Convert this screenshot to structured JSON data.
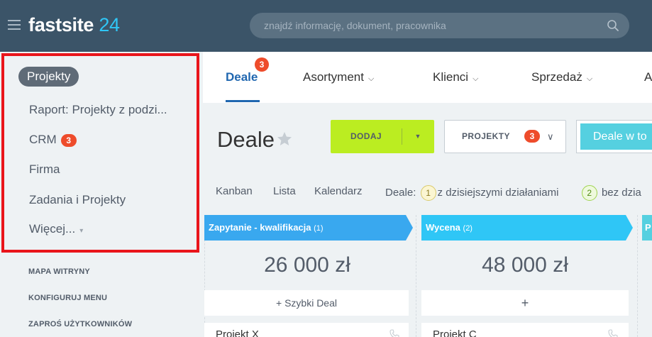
{
  "header": {
    "logo_text": "fastsite",
    "logo_num": "24",
    "search_placeholder": "znajdź informację, dokument, pracownika"
  },
  "sidebar": {
    "items": [
      {
        "label": "Projekty",
        "active": true
      },
      {
        "label": "Raport: Projekty z podzi..."
      },
      {
        "label": "CRM",
        "badge": "3"
      },
      {
        "label": "Firma"
      },
      {
        "label": "Zadania i Projekty"
      },
      {
        "label": "Więcej..."
      }
    ],
    "footer": [
      "MAPA WITRYNY",
      "KONFIGURUJ MENU",
      "ZAPROŚ UŻYTKOWNIKÓW"
    ]
  },
  "tabs": [
    {
      "label": "Deale",
      "badge": "3",
      "active": true
    },
    {
      "label": "Asortyment"
    },
    {
      "label": "Klienci"
    },
    {
      "label": "Sprzedaż"
    },
    {
      "label": "A"
    }
  ],
  "page": {
    "title": "Deale",
    "add_label": "DODAJ",
    "projekty_label": "PROJEKTY",
    "projekty_badge": "3",
    "deale_w_label": "Deale w to"
  },
  "views": {
    "kanban": "Kanban",
    "lista": "Lista",
    "kalendarz": "Kalendarz",
    "deale_label": "Deale:",
    "today_count": "1",
    "today_text": "z dzisiejszymi działaniami",
    "without_count": "2",
    "without_text": "bez dzia"
  },
  "kanban": {
    "columns": [
      {
        "name": "Zapytanie - kwalifikacja",
        "count": "(1)",
        "sum": "26 000 zł",
        "quick_add": "+ Szybki Deal",
        "deal": "Projekt X",
        "color": "#39a8ef"
      },
      {
        "name": "Wycena",
        "count": "(2)",
        "sum": "48 000 zł",
        "quick_add": "+",
        "deal": "Projekt C",
        "color": "#2fc6f6"
      },
      {
        "name": "P",
        "color": "#55d0e0"
      }
    ]
  },
  "colors": {
    "topbar": "#3b5468",
    "accent": "#2fc6f6",
    "badge": "#ee4c2b",
    "add_button": "#bbed21",
    "highlight_box": "#e9151b"
  }
}
